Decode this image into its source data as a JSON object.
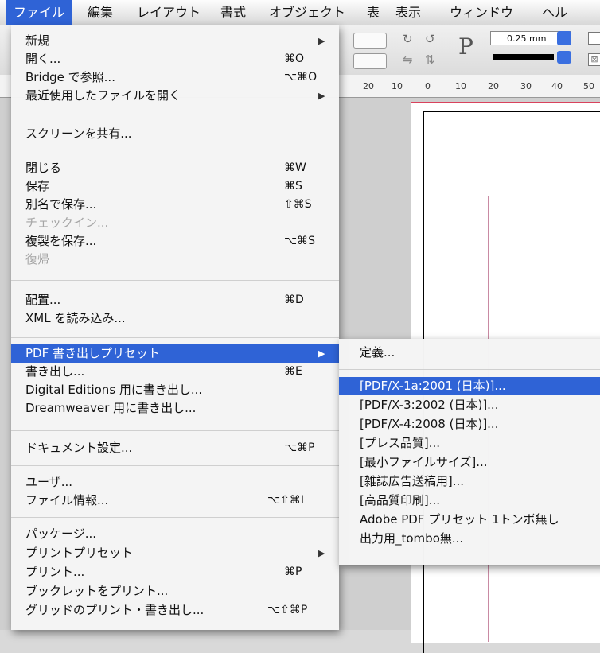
{
  "menubar": {
    "items": [
      "ファイル",
      "編集",
      "レイアウト",
      "書式",
      "オブジェクト",
      "表",
      "表示",
      "ウィンドウ",
      "ヘル"
    ]
  },
  "toolbar": {
    "stroke_weight": "0.25 mm",
    "p_glyph": "P"
  },
  "ruler": {
    "ticks": [
      "20",
      "10",
      "0",
      "10",
      "20",
      "30",
      "40",
      "50"
    ]
  },
  "file_menu": {
    "items": [
      {
        "label": "新規",
        "shortcut": "",
        "submenu": true,
        "disabled": false
      },
      {
        "label": "開く...",
        "shortcut": "⌘O",
        "submenu": false,
        "disabled": false
      },
      {
        "label": "Bridge で参照...",
        "shortcut": "⌥⌘O",
        "submenu": false,
        "disabled": false
      },
      {
        "label": "最近使用したファイルを開く",
        "shortcut": "",
        "submenu": true,
        "disabled": false
      },
      {
        "label": "スクリーンを共有...",
        "shortcut": "",
        "submenu": false,
        "disabled": false
      },
      {
        "label": "閉じる",
        "shortcut": "⌘W",
        "submenu": false,
        "disabled": false
      },
      {
        "label": "保存",
        "shortcut": "⌘S",
        "submenu": false,
        "disabled": false
      },
      {
        "label": "別名で保存...",
        "shortcut": "⇧⌘S",
        "submenu": false,
        "disabled": false
      },
      {
        "label": "チェックイン...",
        "shortcut": "",
        "submenu": false,
        "disabled": true
      },
      {
        "label": "複製を保存...",
        "shortcut": "⌥⌘S",
        "submenu": false,
        "disabled": false
      },
      {
        "label": "復帰",
        "shortcut": "",
        "submenu": false,
        "disabled": true
      },
      {
        "label": "配置...",
        "shortcut": "⌘D",
        "submenu": false,
        "disabled": false
      },
      {
        "label": "XML を読み込み...",
        "shortcut": "",
        "submenu": false,
        "disabled": false
      },
      {
        "label": "PDF 書き出しプリセット",
        "shortcut": "",
        "submenu": true,
        "disabled": false
      },
      {
        "label": "書き出し...",
        "shortcut": "⌘E",
        "submenu": false,
        "disabled": false
      },
      {
        "label": "Digital Editions 用に書き出し...",
        "shortcut": "",
        "submenu": false,
        "disabled": false
      },
      {
        "label": "Dreamweaver 用に書き出し...",
        "shortcut": "",
        "submenu": false,
        "disabled": false
      },
      {
        "label": "ドキュメント設定...",
        "shortcut": "⌥⌘P",
        "submenu": false,
        "disabled": false
      },
      {
        "label": "ユーザ...",
        "shortcut": "",
        "submenu": false,
        "disabled": false
      },
      {
        "label": "ファイル情報...",
        "shortcut": "⌥⇧⌘I",
        "submenu": false,
        "disabled": false
      },
      {
        "label": "パッケージ...",
        "shortcut": "",
        "submenu": false,
        "disabled": false
      },
      {
        "label": "プリントプリセット",
        "shortcut": "",
        "submenu": true,
        "disabled": false
      },
      {
        "label": "プリント...",
        "shortcut": "⌘P",
        "submenu": false,
        "disabled": false
      },
      {
        "label": "ブックレットをプリント...",
        "shortcut": "",
        "submenu": false,
        "disabled": false
      },
      {
        "label": "グリッドのプリント・書き出し...",
        "shortcut": "⌥⇧⌘P",
        "submenu": false,
        "disabled": false
      }
    ]
  },
  "pdf_submenu": {
    "items": [
      "定義...",
      "[PDF/X-1a:2001 (日本)]...",
      "[PDF/X-3:2002 (日本)]...",
      "[PDF/X-4:2008 (日本)]...",
      "[プレス品質]...",
      "[最小ファイルサイズ]...",
      "[雑誌広告送稿用]...",
      "[高品質印刷]...",
      "Adobe PDF プリセット 1トンボ無し",
      "出力用_tombo無..."
    ]
  },
  "colors": {
    "highlight": "#2f63d6",
    "bleed_guide": "#d9425c",
    "margin_guide": "#c98aa3"
  }
}
